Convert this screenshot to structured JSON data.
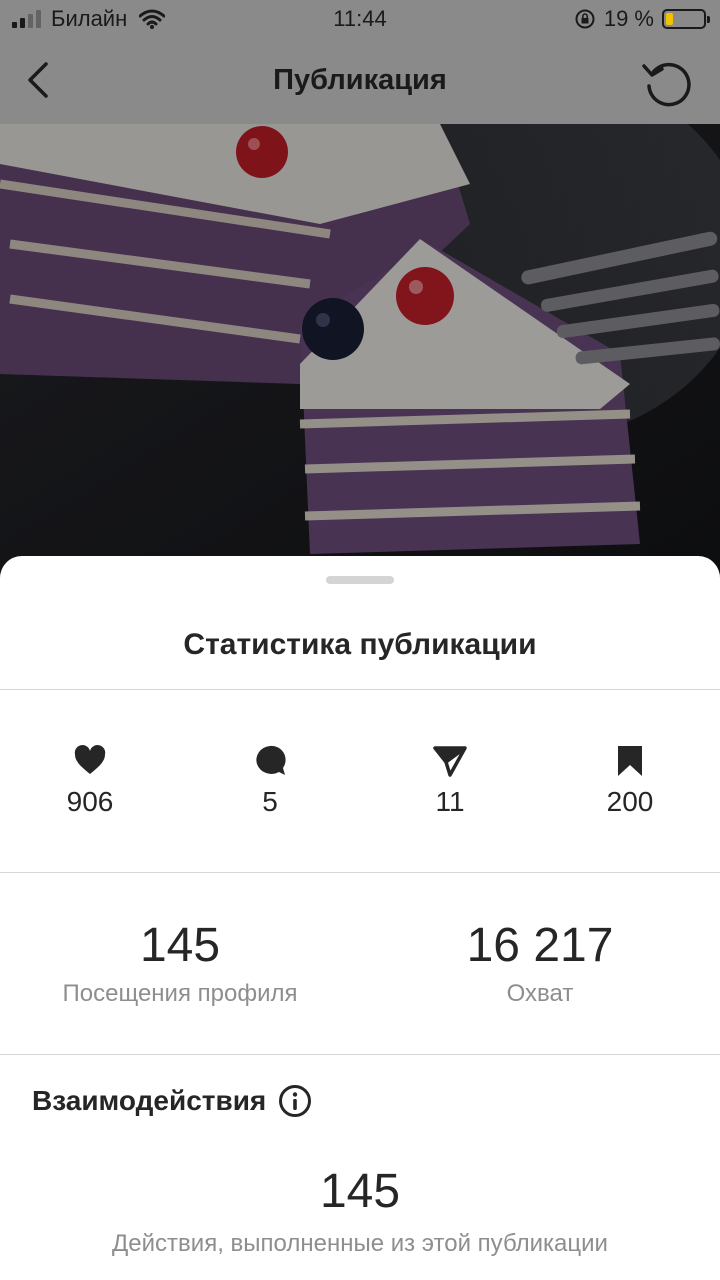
{
  "status_bar": {
    "carrier": "Билайн",
    "time": "11:44",
    "battery": "19 %",
    "battery_level": 0.19
  },
  "header": {
    "title": "Публикация",
    "back_icon": "chevron-left-icon",
    "refresh_icon": "refresh-icon"
  },
  "photo": {
    "mute_icon": "speaker-muted-icon"
  },
  "sheet": {
    "title": "Статистика публикации",
    "metrics": [
      {
        "icon": "heart-icon",
        "value": "906"
      },
      {
        "icon": "comment-icon",
        "value": "5"
      },
      {
        "icon": "send-icon",
        "value": "11"
      },
      {
        "icon": "bookmark-icon",
        "value": "200"
      }
    ],
    "profile_visits": {
      "value": "145",
      "label": "Посещения профиля"
    },
    "reach": {
      "value": "16 217",
      "label": "Охват"
    },
    "interactions": {
      "title": "Взаимодействия",
      "value": "145",
      "label": "Действия, выполненные из этой публикации"
    }
  },
  "colors": {
    "dim_overlay": "#8a8a8a",
    "sheet_bg": "#ffffff",
    "text_primary": "#262626",
    "text_secondary": "#8e8e8e",
    "battery_fill": "#f2c200"
  }
}
